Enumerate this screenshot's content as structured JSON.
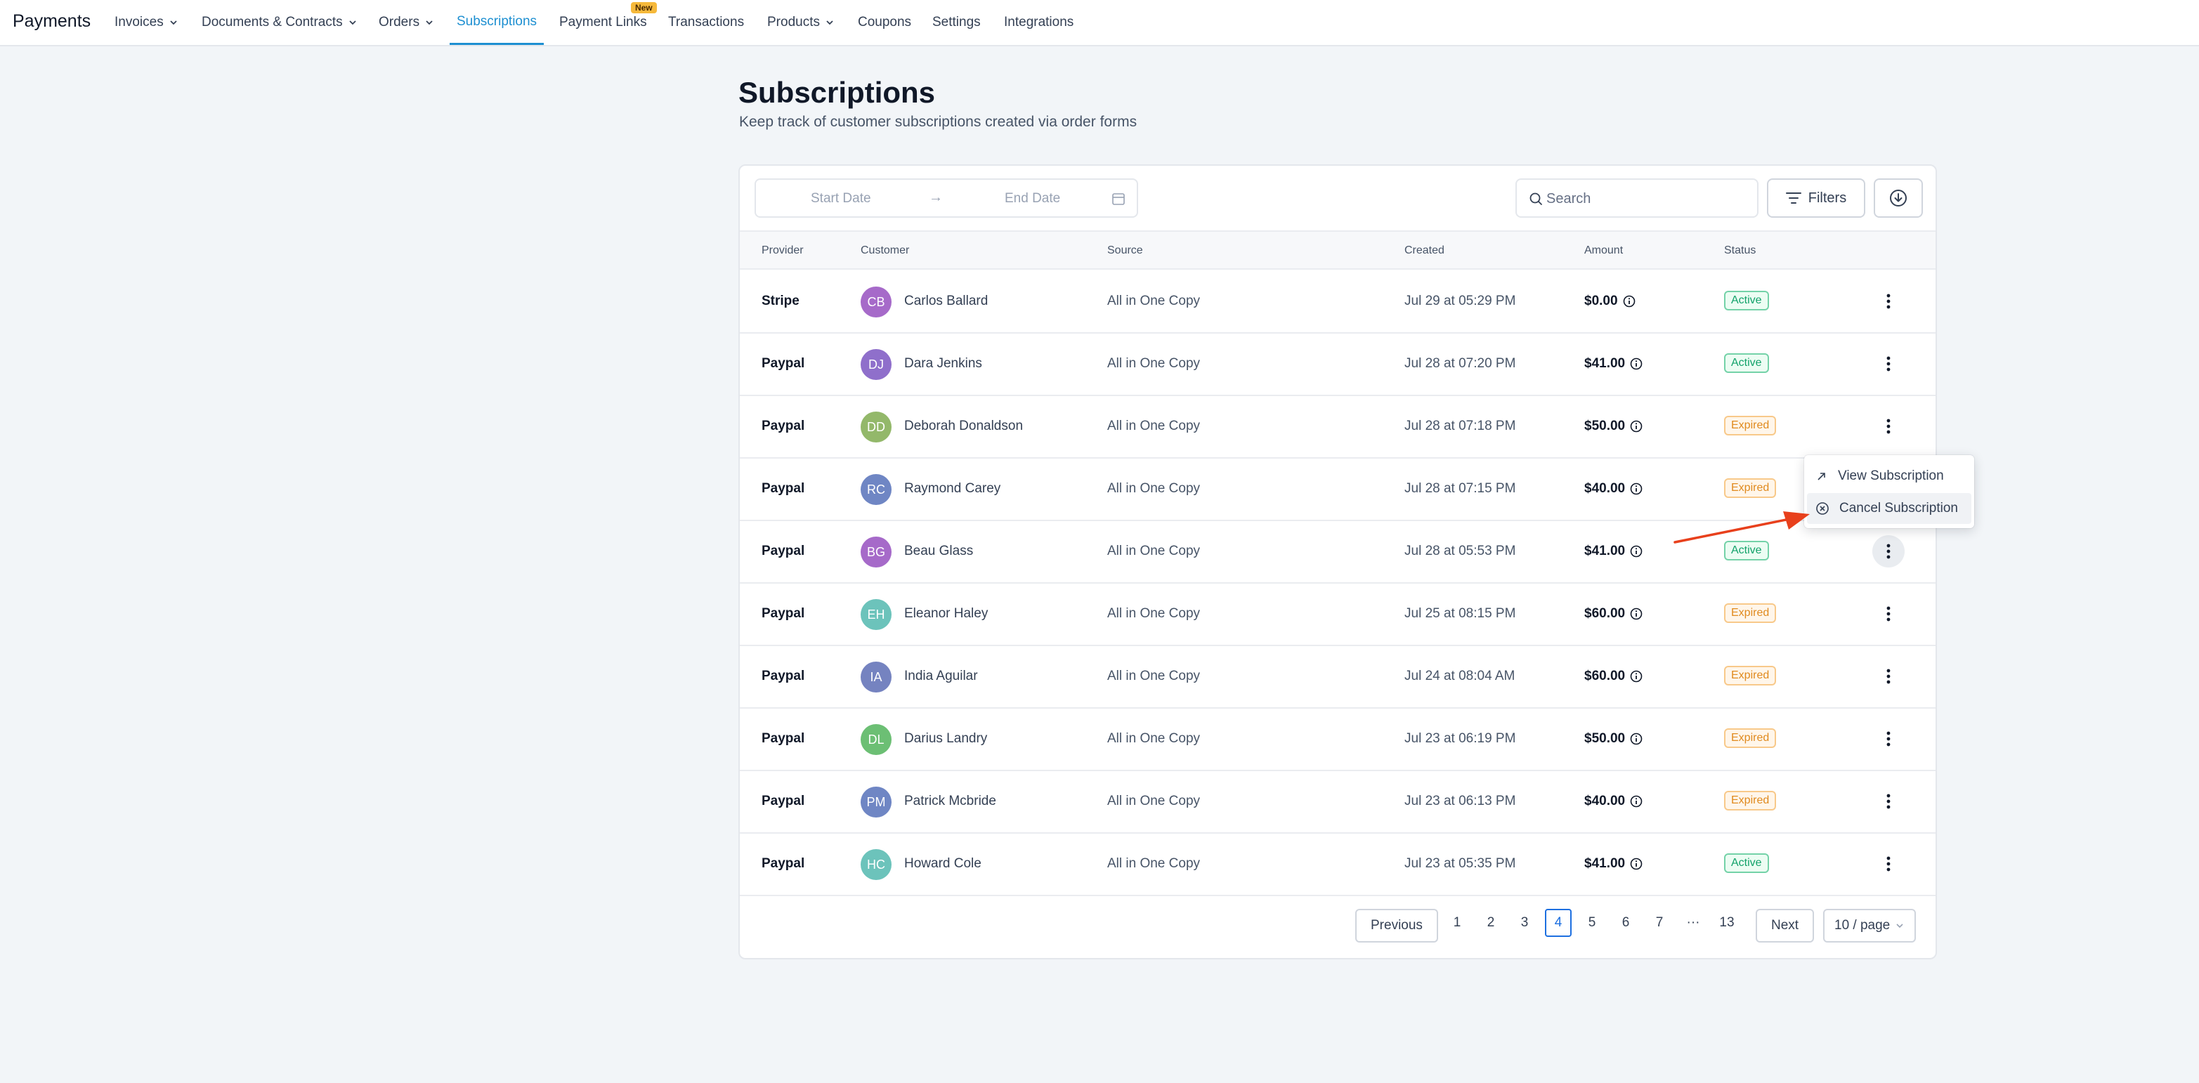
{
  "nav": {
    "brand": "Payments",
    "items": [
      {
        "label": "Invoices",
        "dropdown": true
      },
      {
        "label": "Documents & Contracts",
        "dropdown": true
      },
      {
        "label": "Orders",
        "dropdown": true
      },
      {
        "label": "Subscriptions",
        "active": true
      },
      {
        "label": "Payment Links",
        "badge": "New"
      },
      {
        "label": "Transactions"
      },
      {
        "label": "Products",
        "dropdown": true
      },
      {
        "label": "Coupons"
      },
      {
        "label": "Settings"
      },
      {
        "label": "Integrations"
      }
    ]
  },
  "header": {
    "title": "Subscriptions",
    "subtitle": "Keep track of customer subscriptions created via order forms"
  },
  "toolbar": {
    "start_date_placeholder": "Start Date",
    "end_date_placeholder": "End Date",
    "date_arrow": "→",
    "search_placeholder": "Search",
    "filters_label": "Filters"
  },
  "table": {
    "columns": [
      "Provider",
      "Customer",
      "Source",
      "Created",
      "Amount",
      "Status"
    ],
    "rows": [
      {
        "provider": "Stripe",
        "initials": "CB",
        "avatar_color": "#a66ac9",
        "customer": "Carlos Ballard",
        "source": "All in One Copy",
        "created": "Jul 29 at 05:29 PM",
        "amount": "$0.00",
        "status": "Active"
      },
      {
        "provider": "Paypal",
        "initials": "DJ",
        "avatar_color": "#8f6fcb",
        "customer": "Dara Jenkins",
        "source": "All in One Copy",
        "created": "Jul 28 at 07:20 PM",
        "amount": "$41.00",
        "status": "Active"
      },
      {
        "provider": "Paypal",
        "initials": "DD",
        "avatar_color": "#93b86a",
        "customer": "Deborah Donaldson",
        "source": "All in One Copy",
        "created": "Jul 28 at 07:18 PM",
        "amount": "$50.00",
        "status": "Expired"
      },
      {
        "provider": "Paypal",
        "initials": "RC",
        "avatar_color": "#6f86c4",
        "customer": "Raymond Carey",
        "source": "All in One Copy",
        "created": "Jul 28 at 07:15 PM",
        "amount": "$40.00",
        "status": "Expired"
      },
      {
        "provider": "Paypal",
        "initials": "BG",
        "avatar_color": "#a66ac9",
        "customer": "Beau Glass",
        "source": "All in One Copy",
        "created": "Jul 28 at 05:53 PM",
        "amount": "$41.00",
        "status": "Active"
      },
      {
        "provider": "Paypal",
        "initials": "EH",
        "avatar_color": "#6cc3bb",
        "customer": "Eleanor Haley",
        "source": "All in One Copy",
        "created": "Jul 25 at 08:15 PM",
        "amount": "$60.00",
        "status": "Expired"
      },
      {
        "provider": "Paypal",
        "initials": "IA",
        "avatar_color": "#7583c0",
        "customer": "India Aguilar",
        "source": "All in One Copy",
        "created": "Jul 24 at 08:04 AM",
        "amount": "$60.00",
        "status": "Expired"
      },
      {
        "provider": "Paypal",
        "initials": "DL",
        "avatar_color": "#6cbf74",
        "customer": "Darius Landry",
        "source": "All in One Copy",
        "created": "Jul 23 at 06:19 PM",
        "amount": "$50.00",
        "status": "Expired"
      },
      {
        "provider": "Paypal",
        "initials": "PM",
        "avatar_color": "#6f86c4",
        "customer": "Patrick Mcbride",
        "source": "All in One Copy",
        "created": "Jul 23 at 06:13 PM",
        "amount": "$40.00",
        "status": "Expired"
      },
      {
        "provider": "Paypal",
        "initials": "HC",
        "avatar_color": "#6cc3bb",
        "customer": "Howard Cole",
        "source": "All in One Copy",
        "created": "Jul 23 at 05:35 PM",
        "amount": "$41.00",
        "status": "Active"
      }
    ]
  },
  "row_menu": {
    "open_row": 4,
    "items": [
      {
        "label": "View Subscription",
        "icon": "arrow-up-right-icon"
      },
      {
        "label": "Cancel Subscription",
        "icon": "x-circle-icon"
      }
    ]
  },
  "pagination": {
    "previous_label": "Previous",
    "next_label": "Next",
    "pages": [
      "1",
      "2",
      "3",
      "4",
      "5",
      "6",
      "7",
      "···",
      "13"
    ],
    "current_page": "4",
    "per_page_label": "10 / page"
  },
  "colors": {
    "accent": "#1d8fd1",
    "active_status": "#12a26a",
    "expired_status": "#e08a1e",
    "annotation_arrow": "#e8401c"
  }
}
